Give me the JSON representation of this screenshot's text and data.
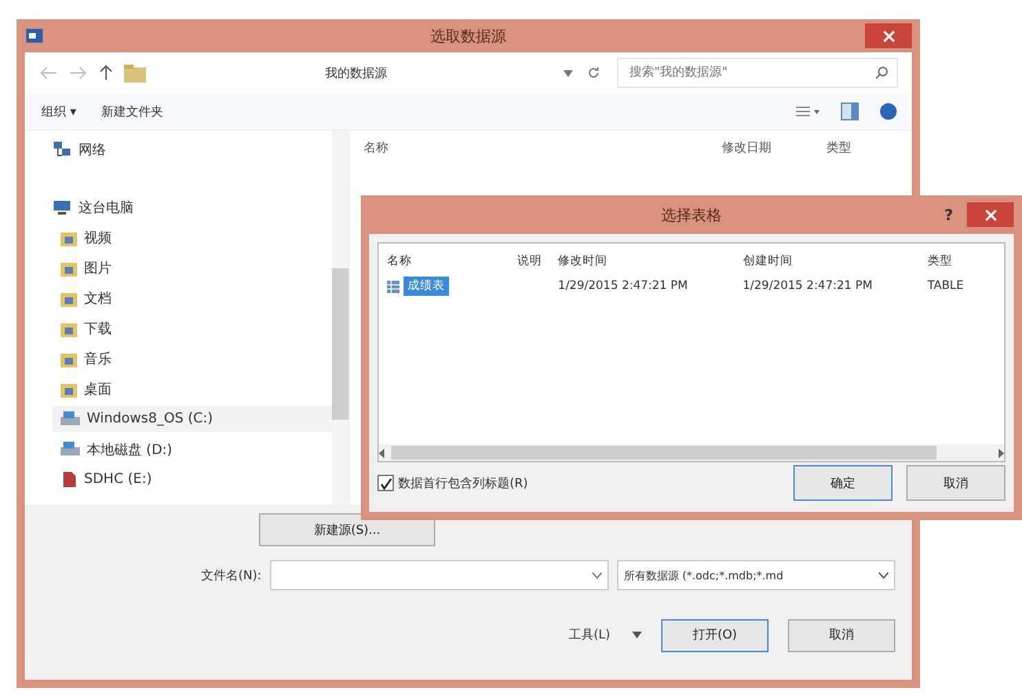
{
  "window": {
    "title": "选取数据源"
  },
  "address_bar": {
    "path": "我的数据源",
    "search_placeholder": "搜索\"我的数据源\""
  },
  "toolbar": {
    "organize": "组织 ▾",
    "new_folder": "新建文件夹"
  },
  "sidebar": {
    "items": [
      {
        "label": "网络",
        "kind": "network"
      },
      {
        "label": "这台电脑",
        "kind": "computer",
        "children": [
          {
            "label": "视频",
            "kind": "folder",
            "selected": false
          },
          {
            "label": "图片",
            "kind": "folder",
            "selected": false
          },
          {
            "label": "文档",
            "kind": "folder",
            "selected": false
          },
          {
            "label": "下载",
            "kind": "folder",
            "selected": false
          },
          {
            "label": "音乐",
            "kind": "folder",
            "selected": false
          },
          {
            "label": "桌面",
            "kind": "folder",
            "selected": false
          },
          {
            "label": "Windows8_OS (C:)",
            "kind": "drive",
            "selected": true
          },
          {
            "label": "本地磁盘 (D:)",
            "kind": "drive",
            "selected": false
          },
          {
            "label": "SDHC (E:)",
            "kind": "sd",
            "selected": false
          }
        ]
      }
    ]
  },
  "file_list": {
    "columns": [
      "名称",
      "修改日期",
      "类型"
    ]
  },
  "new_source_button": "新建源(S)...",
  "file_name": {
    "label": "文件名(N):"
  },
  "file_type": "所有数据源 (*.odc;*.mdb;*.md",
  "tools_button": "工具(L)",
  "buttons": [
    "打开(O)",
    "取消"
  ],
  "dialog": {
    "title": "选择表格",
    "help": "?",
    "columns": [
      "名称",
      "说明",
      "修改时间",
      "创建时间",
      "类型"
    ],
    "rows": [
      {
        "cells": [
          "成绩表",
          "",
          "1/29/2015 2:47:21 PM",
          "1/29/2015 2:47:21 PM",
          "TABLE"
        ],
        "selected": true
      }
    ],
    "header_checkbox": {
      "label": "数据首行包含列标题(R)",
      "checked": true
    },
    "buttons": [
      "确定",
      "取消"
    ]
  }
}
